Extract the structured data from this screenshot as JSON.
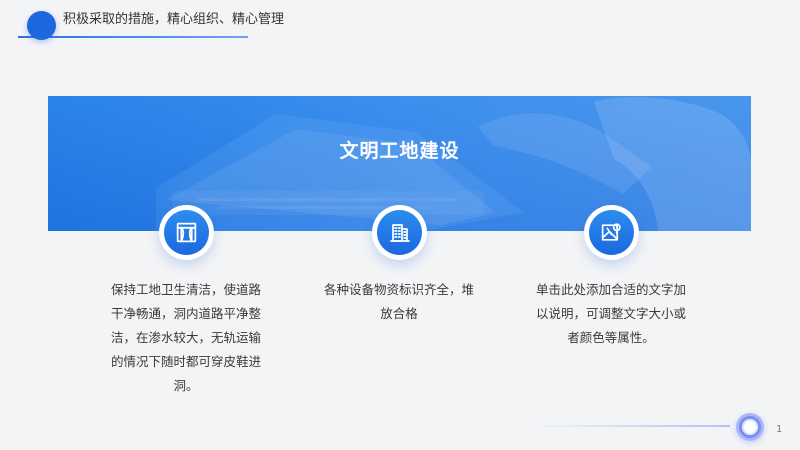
{
  "header": {
    "title": "积极采取的措施，精心组织、精心管理"
  },
  "banner": {
    "title": "文明工地建设"
  },
  "features": [
    {
      "icon": "window-icon",
      "text": "保持工地卫生清洁，使道路干净畅通，洞内道路平净整洁，在渗水较大，无轨运输的情况下随时都可穿皮鞋进洞。"
    },
    {
      "icon": "building-icon",
      "text": "各种设备物资标识齐全，堆放合格"
    },
    {
      "icon": "map-icon",
      "text": "单击此处添加合适的文字加以说明，可调整文字大小或者颜色等属性。"
    }
  ],
  "footer": {
    "page_number": "1"
  }
}
